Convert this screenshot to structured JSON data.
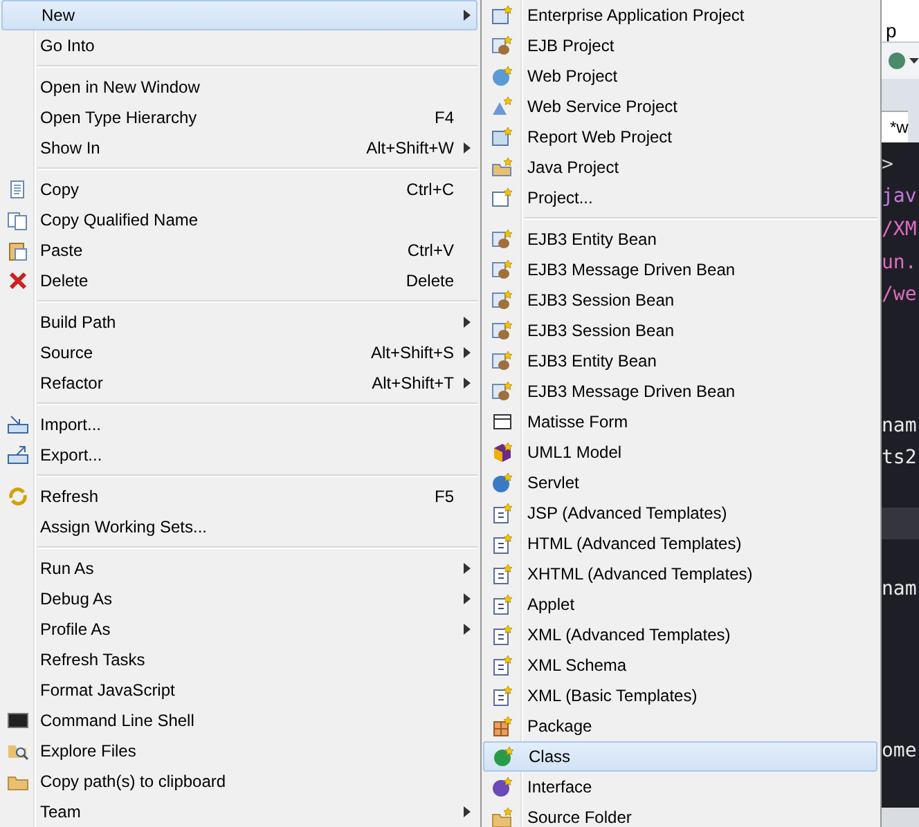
{
  "context_menu": {
    "sections": [
      [
        {
          "label": "New",
          "has_submenu": true,
          "selected": true
        },
        {
          "label": "Go Into",
          "has_submenu": false,
          "selected": false
        }
      ],
      [
        {
          "label": "Open in New Window",
          "has_submenu": false,
          "selected": false
        },
        {
          "label": "Open Type Hierarchy",
          "shortcut": "F4",
          "has_submenu": false,
          "selected": false
        },
        {
          "label": "Show In",
          "shortcut": "Alt+Shift+W",
          "has_submenu": true,
          "selected": false
        }
      ],
      [
        {
          "label": "Copy",
          "shortcut": "Ctrl+C",
          "has_submenu": false,
          "selected": false
        },
        {
          "label": "Copy Qualified Name",
          "has_submenu": false,
          "selected": false
        },
        {
          "label": "Paste",
          "shortcut": "Ctrl+V",
          "has_submenu": false,
          "selected": false
        },
        {
          "label": "Delete",
          "shortcut": "Delete",
          "has_submenu": false,
          "selected": false
        }
      ],
      [
        {
          "label": "Build Path",
          "has_submenu": true,
          "selected": false
        },
        {
          "label": "Source",
          "shortcut": "Alt+Shift+S",
          "has_submenu": true,
          "selected": false
        },
        {
          "label": "Refactor",
          "shortcut": "Alt+Shift+T",
          "has_submenu": true,
          "selected": false
        }
      ],
      [
        {
          "label": "Import...",
          "has_submenu": false,
          "selected": false
        },
        {
          "label": "Export...",
          "has_submenu": false,
          "selected": false
        }
      ],
      [
        {
          "label": "Refresh",
          "shortcut": "F5",
          "has_submenu": false,
          "selected": false
        },
        {
          "label": "Assign Working Sets...",
          "has_submenu": false,
          "selected": false
        }
      ],
      [
        {
          "label": "Run As",
          "has_submenu": true,
          "selected": false
        },
        {
          "label": "Debug As",
          "has_submenu": true,
          "selected": false
        },
        {
          "label": "Profile As",
          "has_submenu": true,
          "selected": false
        },
        {
          "label": "Refresh Tasks",
          "has_submenu": false,
          "selected": false
        },
        {
          "label": "Format JavaScript",
          "has_submenu": false,
          "selected": false
        },
        {
          "label": "Command Line Shell",
          "has_submenu": false,
          "selected": false
        },
        {
          "label": "Explore Files",
          "has_submenu": false,
          "selected": false
        },
        {
          "label": "Copy path(s) to clipboard",
          "has_submenu": false,
          "selected": false
        },
        {
          "label": "Team",
          "has_submenu": true,
          "selected": false
        }
      ]
    ]
  },
  "new_submenu": {
    "sections": [
      [
        {
          "label": "Enterprise Application Project",
          "selected": false
        },
        {
          "label": "EJB Project",
          "selected": false
        },
        {
          "label": "Web Project",
          "selected": false
        },
        {
          "label": "Web Service Project",
          "selected": false
        },
        {
          "label": "Report Web Project",
          "selected": false
        },
        {
          "label": "Java Project",
          "selected": false
        },
        {
          "label": "Project...",
          "selected": false
        }
      ],
      [
        {
          "label": "EJB3 Entity Bean",
          "selected": false
        },
        {
          "label": "EJB3 Message Driven Bean",
          "selected": false
        },
        {
          "label": "EJB3 Session Bean",
          "selected": false
        },
        {
          "label": "EJB3 Session Bean",
          "selected": false
        },
        {
          "label": "EJB3 Entity Bean",
          "selected": false
        },
        {
          "label": "EJB3 Message Driven Bean",
          "selected": false
        },
        {
          "label": "Matisse Form",
          "selected": false
        },
        {
          "label": "UML1 Model",
          "selected": false
        },
        {
          "label": "Servlet",
          "selected": false
        },
        {
          "label": "JSP (Advanced Templates)",
          "selected": false
        },
        {
          "label": "HTML (Advanced Templates)",
          "selected": false
        },
        {
          "label": "XHTML (Advanced Templates)",
          "selected": false
        },
        {
          "label": "Applet",
          "selected": false
        },
        {
          "label": "XML (Advanced Templates)",
          "selected": false
        },
        {
          "label": "XML Schema",
          "selected": false
        },
        {
          "label": "XML (Basic Templates)",
          "selected": false
        },
        {
          "label": "Package",
          "selected": false
        },
        {
          "label": "Class",
          "selected": true
        },
        {
          "label": "Interface",
          "selected": false
        },
        {
          "label": "Source Folder",
          "selected": false
        }
      ]
    ]
  },
  "editor": {
    "perspective_tab": "p",
    "editor_tab": "*w",
    "lines": [
      {
        "kind": "code",
        "text": ">",
        "color": "#d0d0d0"
      },
      {
        "kind": "code",
        "text": "jav",
        "color": "#c678dd"
      },
      {
        "kind": "code",
        "text": "/XM",
        "color": "#e06cc0"
      },
      {
        "kind": "code",
        "text": "un.",
        "color": "#e06cc0"
      },
      {
        "kind": "code",
        "text": "/we",
        "color": "#e06cc0"
      },
      {
        "kind": "blank"
      },
      {
        "kind": "blank"
      },
      {
        "kind": "blank"
      },
      {
        "kind": "code",
        "text": "nam",
        "color": "#e8e8e8"
      },
      {
        "kind": "code",
        "text": "ts2",
        "color": "#e8e8e8"
      },
      {
        "kind": "blank"
      },
      {
        "kind": "current_line"
      },
      {
        "kind": "blank"
      },
      {
        "kind": "code",
        "text": "nam",
        "color": "#e8e8e8"
      },
      {
        "kind": "blank"
      },
      {
        "kind": "blank"
      },
      {
        "kind": "blank"
      },
      {
        "kind": "blank"
      },
      {
        "kind": "code",
        "text": "ome",
        "color": "#e8e8e8"
      }
    ]
  }
}
